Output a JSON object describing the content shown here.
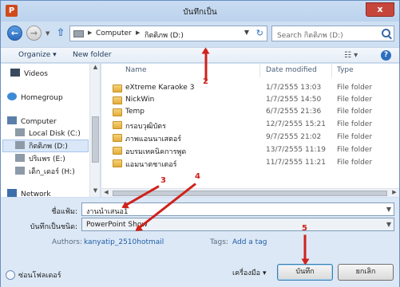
{
  "window": {
    "title": "บันทึกเป็น",
    "app_icon": "P",
    "close": "x"
  },
  "nav": {
    "address": [
      "Computer",
      "กิตติภพ (D:)"
    ],
    "search_placeholder": "Search กิตติภพ (D:)"
  },
  "toolbar": {
    "organize": "Organize ▾",
    "new_folder": "New folder"
  },
  "sidebar": {
    "items": [
      {
        "label": "Videos"
      },
      {
        "label": "Homegroup"
      },
      {
        "label": "Computer"
      },
      {
        "label": "Local Disk (C:)"
      },
      {
        "label": "กิตติภพ (D:)"
      },
      {
        "label": "ปริแพร (E:)"
      },
      {
        "label": "เด็ก_เดอร์ (H:)"
      },
      {
        "label": "Network"
      }
    ]
  },
  "columns": {
    "name": "Name",
    "date": "Date modified",
    "type": "Type"
  },
  "files": [
    {
      "name": "eXtreme Karaoke 3",
      "date": "1/7/2555 13:03",
      "type": "File folder"
    },
    {
      "name": "NickWin",
      "date": "1/7/2555 14:50",
      "type": "File folder"
    },
    {
      "name": "Temp",
      "date": "6/7/2555 21:36",
      "type": "File folder"
    },
    {
      "name": "กรอบวุฒิบัตร",
      "date": "12/7/2555 15:21",
      "type": "File folder"
    },
    {
      "name": "ภาพแอนนาเสตอร์",
      "date": "9/7/2555 21:02",
      "type": "File folder"
    },
    {
      "name": "อบรมเทคนิคการพูด",
      "date": "13/7/2555 11:19",
      "type": "File folder"
    },
    {
      "name": "แอมนาตชาเตอร์",
      "date": "11/7/2555 11:21",
      "type": "File folder"
    }
  ],
  "form": {
    "filename_label": "ชื่อแฟ้ม:",
    "filename_value": "งานนำเสนอ1",
    "filetype_label": "บันทึกเป็นชนิด:",
    "filetype_value": "PowerPoint Show",
    "authors_label": "Authors:",
    "authors_value": "kanyatip_2510hotmail",
    "tags_label": "Tags:",
    "tags_value": "Add a tag"
  },
  "footer": {
    "hide_folders": "ซ่อนโฟลเดอร์",
    "tools": "เครื่องมือ",
    "save": "บันทึก",
    "cancel": "ยกเลิก"
  },
  "annotations": {
    "n2": "2",
    "n3": "3",
    "n4": "4",
    "n5": "5"
  }
}
